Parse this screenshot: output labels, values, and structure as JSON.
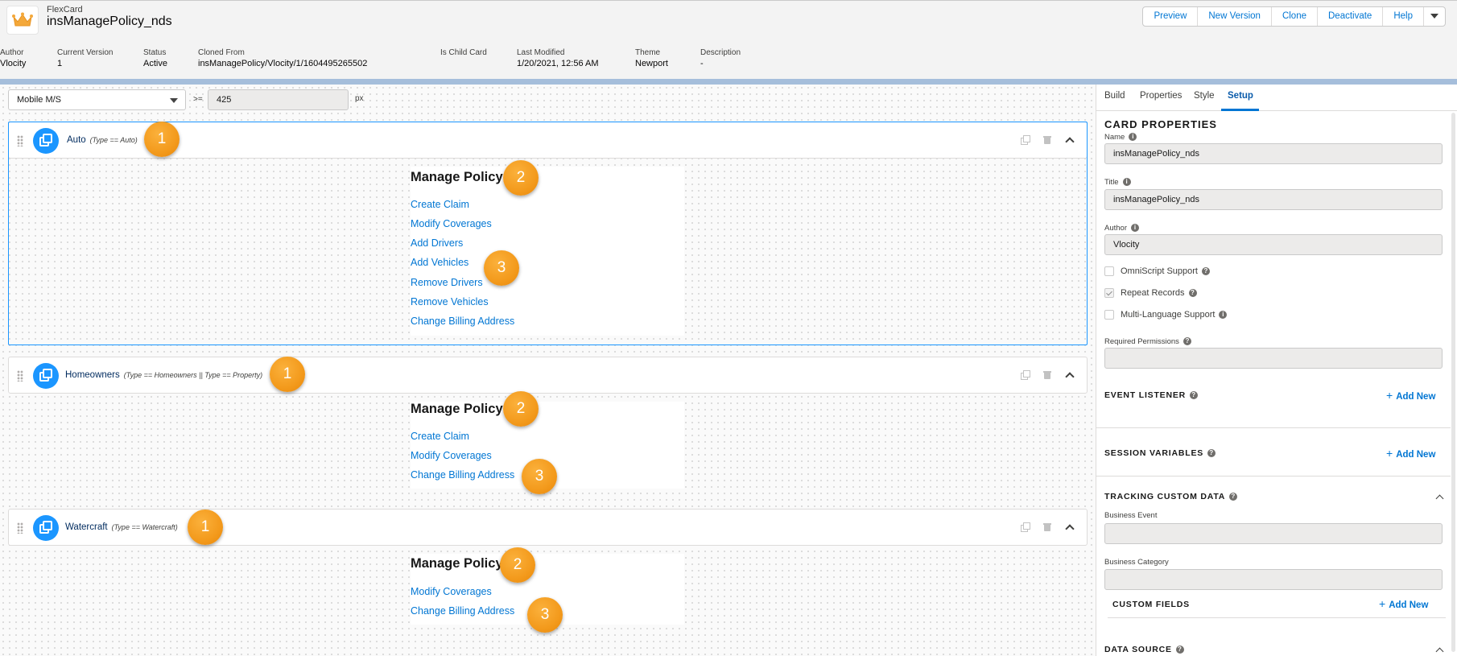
{
  "header": {
    "subtitle": "FlexCard",
    "title": "insManagePolicy_nds",
    "buttons": [
      "Preview",
      "New Version",
      "Clone",
      "Deactivate",
      "Help"
    ]
  },
  "meta": [
    {
      "label": "Author",
      "value": "Vlocity"
    },
    {
      "label": "Current Version",
      "value": "1"
    },
    {
      "label": "Status",
      "value": "Active"
    },
    {
      "label": "Cloned From",
      "value": "insManagePolicy/Vlocity/1/1604495265502"
    },
    {
      "label": "Is Child Card",
      "value": ""
    },
    {
      "label": "Last Modified",
      "value": "1/20/2021, 12:56 AM"
    },
    {
      "label": "Theme",
      "value": "Newport"
    },
    {
      "label": "Description",
      "value": "-"
    }
  ],
  "toolbar": {
    "device": "Mobile M/S",
    "operator": ">=",
    "width_value": "425",
    "unit": "px"
  },
  "states": [
    {
      "name": "Auto",
      "condition": "(Type == Auto)",
      "badge": "1",
      "heading": "Manage Policy",
      "heading_badge": "2",
      "links_badge": "3",
      "links": [
        "Create Claim",
        "Modify Coverages",
        "Add Drivers",
        "Add Vehicles",
        "Remove Drivers",
        "Remove Vehicles",
        "Change Billing Address"
      ]
    },
    {
      "name": "Homeowners",
      "condition": "(Type == Homeowners || Type == Property)",
      "badge": "1",
      "heading": "Manage Policy",
      "heading_badge": "2",
      "links_badge": "3",
      "links": [
        "Create Claim",
        "Modify Coverages",
        "Change Billing Address"
      ]
    },
    {
      "name": "Watercraft",
      "condition": "(Type == Watercraft)",
      "badge": "1",
      "heading": "Manage Policy",
      "heading_badge": "2",
      "links_badge": "3",
      "links": [
        "Modify Coverages",
        "Change Billing Address"
      ]
    }
  ],
  "right_panel": {
    "tabs": [
      "Build",
      "Properties",
      "Style",
      "Setup"
    ],
    "active_tab": "Setup",
    "card_properties_title": "CARD PROPERTIES",
    "name_label": "Name",
    "name_value": "insManagePolicy_nds",
    "title_label": "Title",
    "title_value": "insManagePolicy_nds",
    "author_label": "Author",
    "author_value": "Vlocity",
    "omniscript_label": "OmniScript Support",
    "omniscript_checked": false,
    "repeat_label": "Repeat Records",
    "repeat_checked": true,
    "multilang_label": "Multi-Language Support",
    "multilang_checked": false,
    "required_permissions_label": "Required Permissions",
    "required_permissions_value": "",
    "event_listener_title": "EVENT LISTENER",
    "session_variables_title": "SESSION VARIABLES",
    "tracking_title": "TRACKING CUSTOM DATA",
    "business_event_label": "Business Event",
    "business_category_label": "Business Category",
    "custom_fields_title": "CUSTOM FIELDS",
    "data_source_title": "DATA SOURCE",
    "add_new_label": "Add New",
    "info_glyph": "i",
    "help_glyph": "?",
    "plus_glyph": "+"
  },
  "colors": {
    "link": "#0176d3",
    "badge": "#f39a1c",
    "state_icon": "#1b96ff",
    "selected_outline": "#1b96ff"
  }
}
